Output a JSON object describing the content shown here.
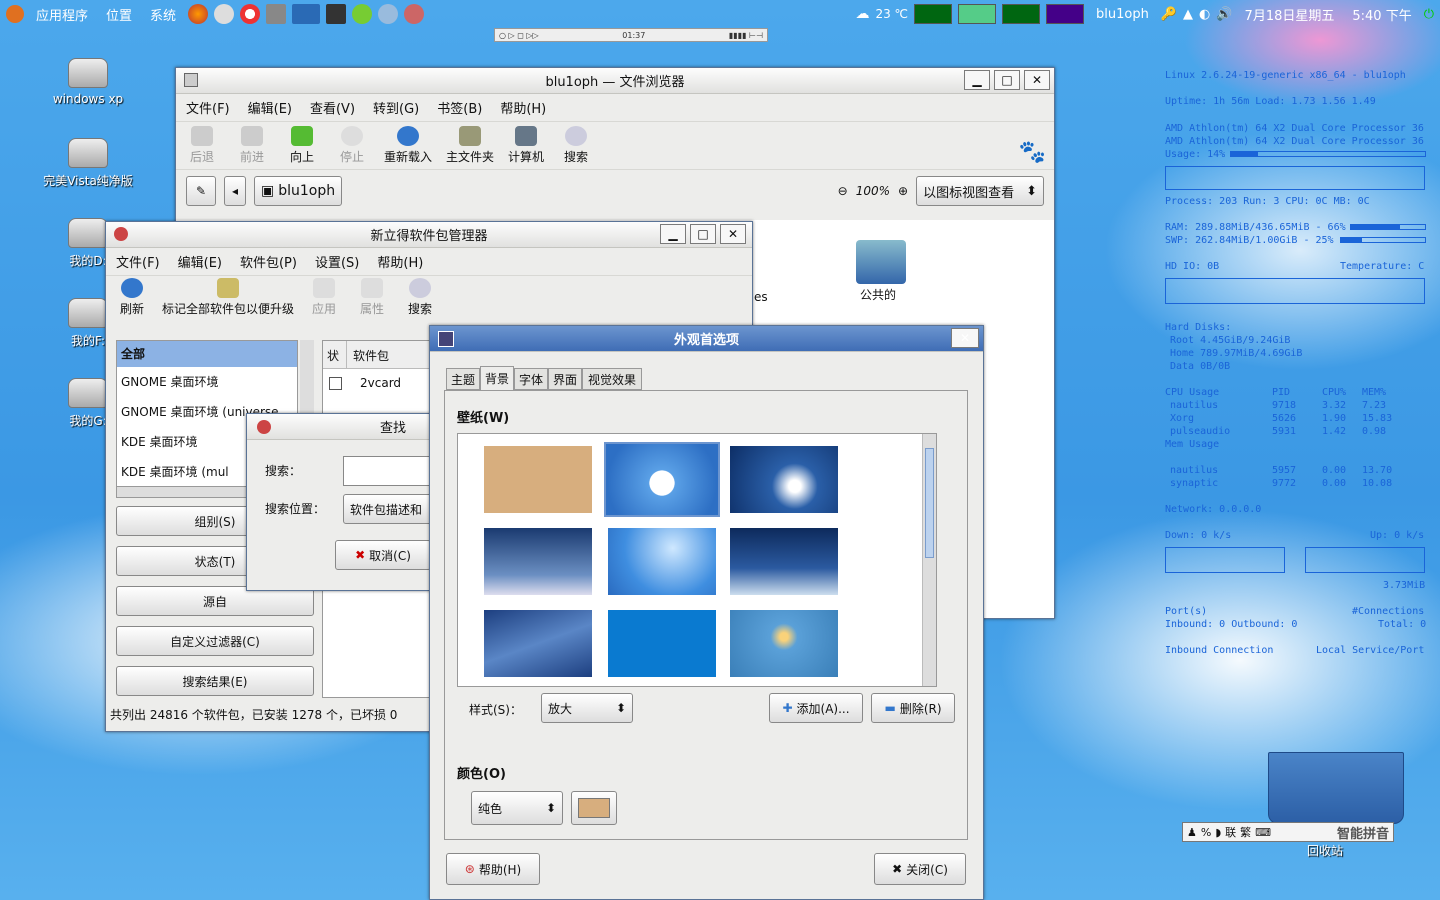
{
  "panel": {
    "menus": [
      "应用程序",
      "位置",
      "系统"
    ],
    "weather": "23 ℃",
    "user": "blu1oph",
    "date": "7月18日星期五",
    "time": "5:40 下午"
  },
  "taskbar_mini": {
    "time": "01:37"
  },
  "desktop": {
    "icons": [
      "windows xp",
      "完美Vista纯净版",
      "我的D:",
      "我的F:",
      "我的G:"
    ]
  },
  "file_browser": {
    "title": "blu1oph — 文件浏览器",
    "menus": [
      "文件(F)",
      "编辑(E)",
      "查看(V)",
      "转到(G)",
      "书签(B)",
      "帮助(H)"
    ],
    "toolbar": [
      "后退",
      "前进",
      "向上",
      "停止",
      "重新载入",
      "主文件夹",
      "计算机",
      "搜索"
    ],
    "path": "blu1oph",
    "zoom": "100%",
    "view_mode": "以图标视图查看",
    "icons": [
      "es",
      "公共的"
    ]
  },
  "synaptic": {
    "title": "新立得软件包管理器",
    "menus": [
      "文件(F)",
      "编辑(E)",
      "软件包(P)",
      "设置(S)",
      "帮助(H)"
    ],
    "toolbar": [
      "刷新",
      "标记全部软件包以便升级",
      "应用",
      "属性",
      "搜索"
    ],
    "categories": [
      "全部",
      "GNOME 桌面环境",
      "GNOME 桌面环境 (universe",
      "KDE 桌面环境",
      "KDE 桌面环境 (mul"
    ],
    "filters": [
      "组别(S)",
      "状态(T)",
      "源自",
      "自定义过滤器(C)",
      "搜索结果(E)"
    ],
    "columns": [
      "状",
      "软件包"
    ],
    "package": "2vcard",
    "status": "共列出 24816 个软件包，已安装 1278 个，已坏损 0"
  },
  "find_dialog": {
    "title": "查找",
    "search_label": "搜索：",
    "search_value": "",
    "location_label": "搜索位置：",
    "location_value": "软件包描述和",
    "cancel": "取消(C)"
  },
  "appearance": {
    "title": "外观首选项",
    "tabs": [
      "主题",
      "背景",
      "字体",
      "界面",
      "视觉效果"
    ],
    "active_tab": "背景",
    "wallpaper_label": "壁纸(W)",
    "style_label": "样式(S)：",
    "style_value": "放大",
    "add": "添加(A)...",
    "remove": "删除(R)",
    "color_label": "颜色(O)",
    "color_mode": "纯色",
    "color_swatch": "#d7ae7e",
    "help": "帮助(H)",
    "close": "关闭(C)"
  },
  "conky": {
    "line1": "Linux 2.6.24-19-generic x86_64 - blu1oph",
    "uptime": "Uptime: 1h 56m   Load: 1.73 1.56 1.49",
    "cpu1": "AMD Athlon(tm) 64 X2 Dual Core Processor 36",
    "cpu2": "AMD Athlon(tm) 64 X2 Dual Core Processor 36",
    "usage": "Usage: 14%",
    "procs": "Process: 203   Run: 3  CPU: 0C  MB: 0C",
    "ram": "RAM: 289.88MiB/436.65MiB - 66%",
    "swap": "SWP: 262.84MiB/1.00GiB - 25%",
    "hdio": "HD IO: 0B",
    "temp": "Temperature: C",
    "disks": "Hard Disks:",
    "root": "Root  4.45GiB/9.24GiB",
    "home": "Home  789.97MiB/4.69GiB",
    "data": "Data  0B/0B",
    "cpu_usage": "CPU Usage",
    "pid": "PID",
    "cpu": "CPU%",
    "mem": "MEM%",
    "procs_cpu": [
      [
        "nautilus",
        "9718",
        "3.32",
        "7.23"
      ],
      [
        "Xorg",
        "5626",
        "1.90",
        "15.83"
      ],
      [
        "pulseaudio",
        "5931",
        "1.42",
        "0.98"
      ]
    ],
    "mem_usage": "Mem Usage",
    "procs_mem": [
      [
        "nautilus",
        "5957",
        "0.00",
        "13.70"
      ],
      [
        "synaptic",
        "9772",
        "0.00",
        "10.08"
      ]
    ],
    "network": "Network: 0.0.0.0",
    "down": "Down: 0 k/s",
    "up": "Up: 0 k/s",
    "total": "3.73MiB",
    "ports": "Port(s)",
    "connections": "#Connections",
    "inbound": "Inbound: 0  Outbound: 0",
    "total_conn": "Total: 0",
    "inbound_conn": "Inbound Connection",
    "local": "Local Service/Port"
  },
  "ime": {
    "label": "智能拼音"
  },
  "trash": {
    "label": "回收站"
  }
}
